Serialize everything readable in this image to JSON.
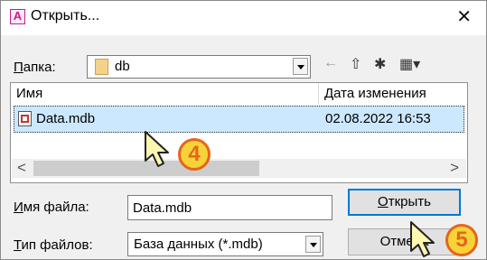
{
  "window": {
    "title": "Открыть...",
    "close_glyph": "✕",
    "app_icon_letter": "A"
  },
  "folder": {
    "label_u": "П",
    "label_rest": "апка:",
    "value": "db"
  },
  "toolbar": {
    "back_glyph": "←",
    "up_glyph": "⇧",
    "new_folder_glyph": "✱",
    "view_glyph": "▦▾"
  },
  "filelist": {
    "header": {
      "name": "Имя",
      "date": "Дата изменения"
    },
    "items": [
      {
        "name": "Data.mdb",
        "date": "02.08.2022 16:53"
      }
    ]
  },
  "scroll": {
    "left": "<",
    "right": ">"
  },
  "filename": {
    "label_u": "И",
    "label_rest": "мя файла:",
    "value": "Data.mdb"
  },
  "filetype": {
    "label_u": "Т",
    "label_rest": "ип файлов:",
    "value": "База данных (*.mdb)"
  },
  "buttons": {
    "open_u": "О",
    "open_rest": "ткрыть",
    "cancel": "Отмена"
  },
  "annotations": {
    "step4": "4",
    "step5": "5",
    "badge_fill": "#f7d33a",
    "badge_border": "#e8641a"
  }
}
